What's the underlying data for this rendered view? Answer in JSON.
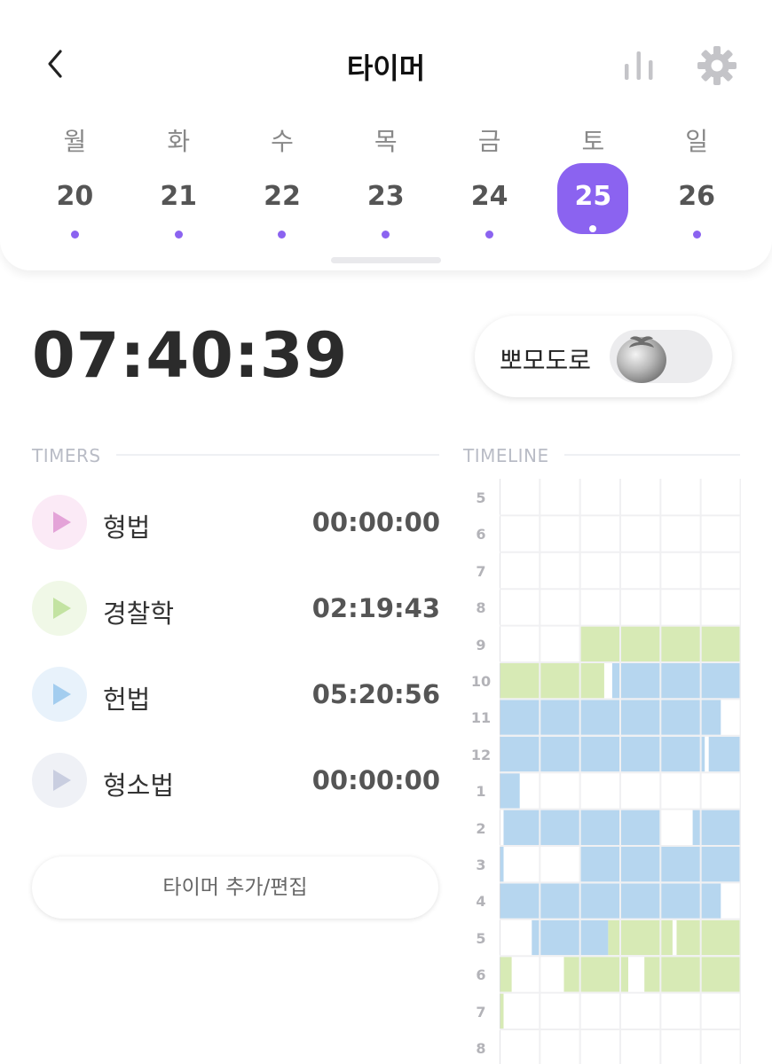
{
  "header": {
    "title": "타이머"
  },
  "week": {
    "days": [
      {
        "name": "월",
        "num": "20",
        "selected": false
      },
      {
        "name": "화",
        "num": "21",
        "selected": false
      },
      {
        "name": "수",
        "num": "22",
        "selected": false
      },
      {
        "name": "목",
        "num": "23",
        "selected": false
      },
      {
        "name": "금",
        "num": "24",
        "selected": false
      },
      {
        "name": "토",
        "num": "25",
        "selected": true
      },
      {
        "name": "일",
        "num": "26",
        "selected": false
      }
    ]
  },
  "elapsed": "07:40:39",
  "pomodoro": {
    "label": "뽀모도로",
    "enabled": false
  },
  "timers_section": {
    "label": "TIMERS",
    "items": [
      {
        "name": "형법",
        "time": "00:00:00",
        "color": "#e4a3d8",
        "bg": "#fbeaf6"
      },
      {
        "name": "경찰학",
        "time": "02:19:43",
        "color": "#c3e3a2",
        "bg": "#f0f8e7"
      },
      {
        "name": "헌법",
        "time": "05:20:56",
        "color": "#a3cdef",
        "bg": "#e8f2fb"
      },
      {
        "name": "형소법",
        "time": "00:00:00",
        "color": "#c9cee0",
        "bg": "#eff1f6"
      }
    ],
    "add_label": "타이머 추가/편집"
  },
  "timeline_section": {
    "label": "TIMELINE",
    "hours": [
      "5",
      "6",
      "7",
      "8",
      "9",
      "10",
      "11",
      "12",
      "1",
      "2",
      "3",
      "4",
      "5",
      "6",
      "7",
      "8"
    ],
    "colors": {
      "green": "#d7eab5",
      "blue": "#b6d6ef"
    },
    "rows": [
      [],
      [],
      [],
      [],
      [
        {
          "start": 20,
          "end": 60,
          "color": "green"
        }
      ],
      [
        {
          "start": 0,
          "end": 26,
          "color": "green"
        },
        {
          "start": 28,
          "end": 60,
          "color": "blue"
        }
      ],
      [
        {
          "start": 0,
          "end": 55,
          "color": "blue"
        }
      ],
      [
        {
          "start": 0,
          "end": 51,
          "color": "blue"
        },
        {
          "start": 52,
          "end": 60,
          "color": "blue"
        }
      ],
      [
        {
          "start": 0,
          "end": 5,
          "color": "blue"
        }
      ],
      [
        {
          "start": 1,
          "end": 40,
          "color": "blue"
        },
        {
          "start": 48,
          "end": 60,
          "color": "blue"
        }
      ],
      [
        {
          "start": 0,
          "end": 1,
          "color": "blue"
        },
        {
          "start": 20,
          "end": 60,
          "color": "blue"
        }
      ],
      [
        {
          "start": 0,
          "end": 55,
          "color": "blue"
        }
      ],
      [
        {
          "start": 8,
          "end": 27,
          "color": "blue"
        },
        {
          "start": 27,
          "end": 43,
          "color": "green"
        },
        {
          "start": 44,
          "end": 60,
          "color": "green"
        }
      ],
      [
        {
          "start": 0,
          "end": 3,
          "color": "green"
        },
        {
          "start": 16,
          "end": 32,
          "color": "green"
        },
        {
          "start": 36,
          "end": 60,
          "color": "green"
        }
      ],
      [
        {
          "start": 0,
          "end": 1,
          "color": "green"
        }
      ],
      []
    ]
  }
}
